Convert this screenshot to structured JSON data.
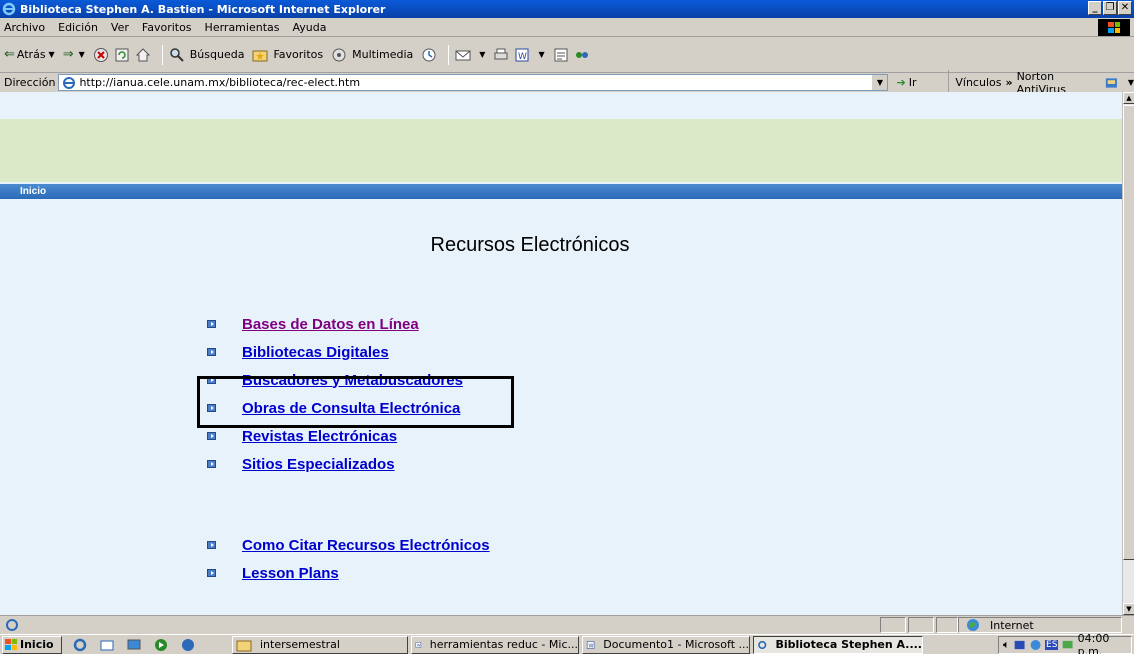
{
  "window": {
    "title": "Biblioteca Stephen A. Bastien - Microsoft Internet Explorer",
    "controls": [
      "_",
      "❐",
      "✕"
    ]
  },
  "menu": [
    "Archivo",
    "Edición",
    "Ver",
    "Favoritos",
    "Herramientas",
    "Ayuda"
  ],
  "toolbar": {
    "back": "Atrás",
    "search": "Búsqueda",
    "favorites": "Favoritos",
    "multimedia": "Multimedia"
  },
  "address": {
    "label": "Dirección",
    "url": "http://ianua.cele.unam.mx/biblioteca/rec-elect.htm",
    "go": "Ir",
    "links_label": "Vínculos",
    "links_item": "Norton AntiVirus"
  },
  "page": {
    "nav_label": "Inicio",
    "title": "Recursos Electrónicos",
    "links": [
      {
        "label": "Bases de Datos en Línea",
        "visited": true
      },
      {
        "label": "Bibliotecas Digitales",
        "visited": false
      },
      {
        "label": "Buscadores y Metabuscadores",
        "visited": false
      },
      {
        "label": "Obras de Consulta Electrónica",
        "visited": false
      },
      {
        "label": "Revistas Electrónicas",
        "visited": false
      },
      {
        "label": "Sitios Especializados",
        "visited": false
      }
    ],
    "links_secondary": [
      {
        "label": "Como Citar Recursos Electrónicos"
      },
      {
        "label": "Lesson Plans"
      }
    ]
  },
  "status": {
    "zone": "Internet"
  },
  "taskbar": {
    "start": "Inicio",
    "tasks": [
      {
        "label": "intersemestral",
        "active": false
      },
      {
        "label": "herramientas reduc - Mic...",
        "active": false
      },
      {
        "label": "Documento1 - Microsoft ...",
        "active": false
      },
      {
        "label": "Biblioteca Stephen A....",
        "active": true
      }
    ],
    "tray_lang": "ES",
    "clock": "04:00 p.m."
  },
  "colors": {
    "link": "#0000cc",
    "visited": "#800080",
    "nav_bar": "#2a6ab8",
    "band": "#dbe9c9",
    "page_bg": "#e8f2fb"
  }
}
